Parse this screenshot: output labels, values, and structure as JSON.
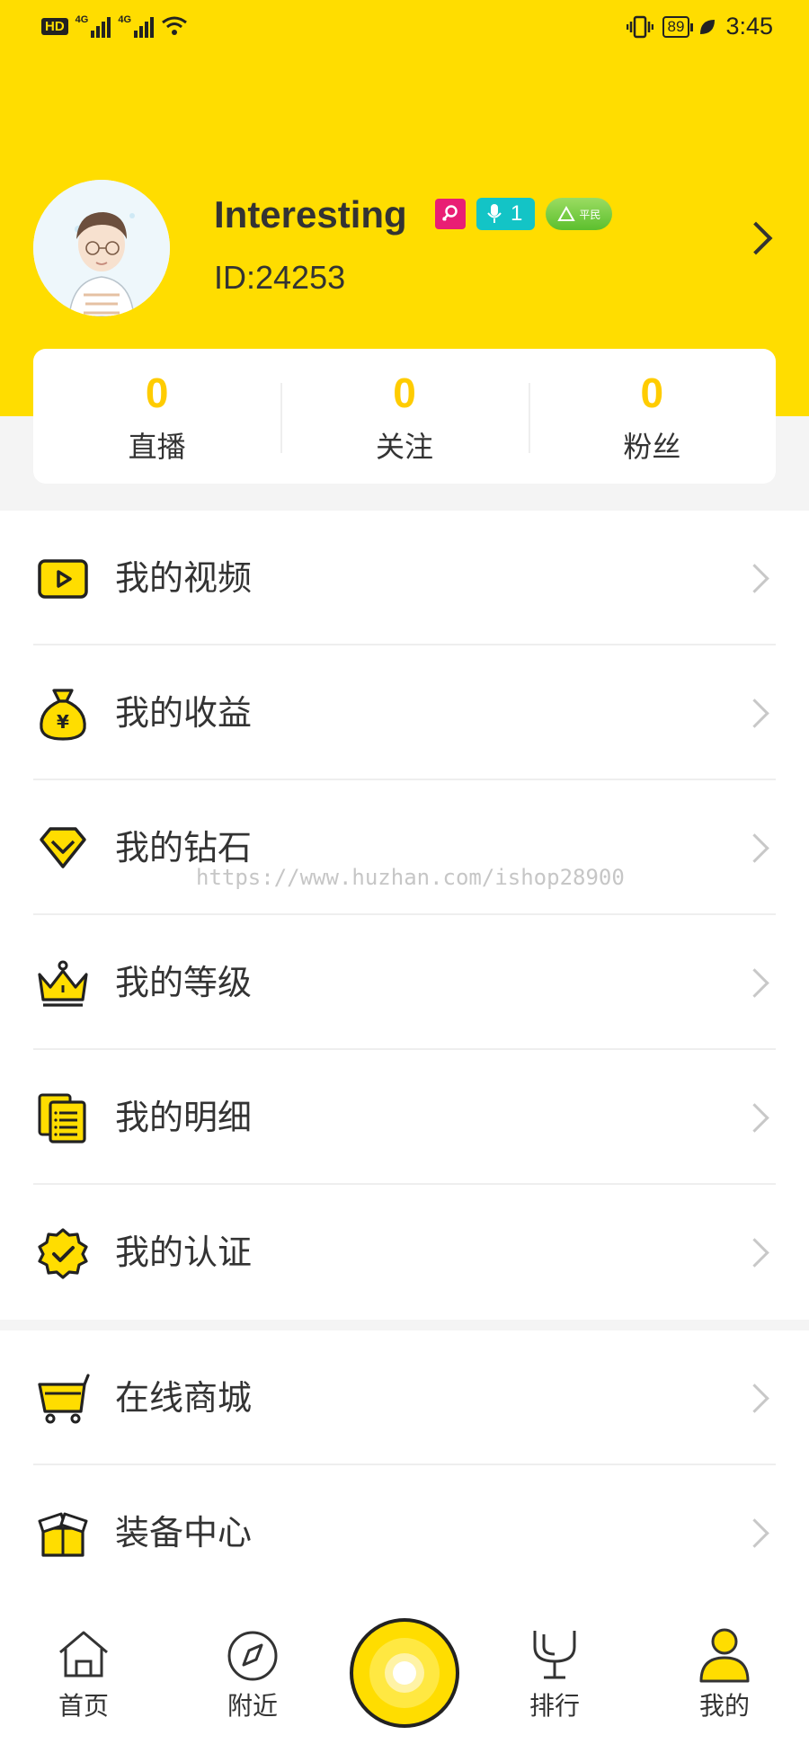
{
  "status_bar": {
    "hd": "HD",
    "network_1": "4G",
    "network_2": "4G",
    "battery": "89",
    "time": "3:45"
  },
  "profile": {
    "username": "Interesting",
    "id_text": "ID:24253",
    "level_badge": "1",
    "rank_badge": "平民"
  },
  "stats": [
    {
      "value": "0",
      "label": "直播"
    },
    {
      "value": "0",
      "label": "关注"
    },
    {
      "value": "0",
      "label": "粉丝"
    }
  ],
  "menu_group_1": [
    {
      "label": "我的视频",
      "icon": "video-icon"
    },
    {
      "label": "我的收益",
      "icon": "money-bag-icon"
    },
    {
      "label": "我的钻石",
      "icon": "diamond-icon"
    },
    {
      "label": "我的等级",
      "icon": "crown-icon"
    },
    {
      "label": "我的明细",
      "icon": "detail-list-icon"
    },
    {
      "label": "我的认证",
      "icon": "certified-badge-icon"
    }
  ],
  "menu_group_2": [
    {
      "label": "在线商城",
      "icon": "shopping-cart-icon"
    },
    {
      "label": "装备中心",
      "icon": "gift-box-icon"
    }
  ],
  "watermark": "https://www.huzhan.com/ishop28900",
  "bottom_nav": [
    {
      "label": "首页",
      "icon": "home-icon"
    },
    {
      "label": "附近",
      "icon": "compass-icon"
    },
    {
      "label": "排行",
      "icon": "trophy-icon"
    },
    {
      "label": "我的",
      "icon": "user-icon"
    }
  ],
  "colors": {
    "brand_yellow": "#ffdd00",
    "stat_number": "#ffcc00",
    "level_badge": "#13c4c6",
    "gender_badge": "#e91e74",
    "rank_badge": "#6cc83a"
  }
}
